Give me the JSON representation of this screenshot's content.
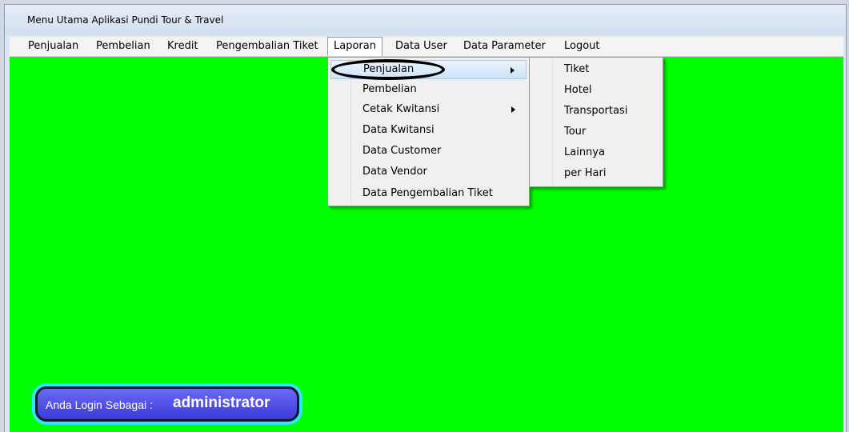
{
  "window": {
    "title": "Menu Utama Aplikasi Pundi Tour & Travel"
  },
  "menubar": {
    "items": [
      "Penjualan",
      "Pembelian",
      "Kredit",
      "Pengembalian Tiket",
      "Laporan",
      "Data User",
      "Data Parameter",
      "Logout"
    ],
    "active": "Laporan"
  },
  "laporan_menu": {
    "items": [
      "Penjualan",
      "Pembelian",
      "Cetak Kwitansi",
      "Data Kwitansi",
      "Data Customer",
      "Data Vendor",
      "Data Pengembalian Tiket"
    ],
    "highlighted": "Penjualan"
  },
  "penjualan_submenu": {
    "items": [
      "Tiket",
      "Hotel",
      "Transportasi",
      "Tour",
      "Lainnya",
      "per Hari"
    ]
  },
  "login": {
    "label": "Anda Login Sebagai :",
    "user": "administrator"
  },
  "colors": {
    "workspace": "#00ff00",
    "badge": "#4a4ae8",
    "badge_glow": "#2ee6ff"
  }
}
